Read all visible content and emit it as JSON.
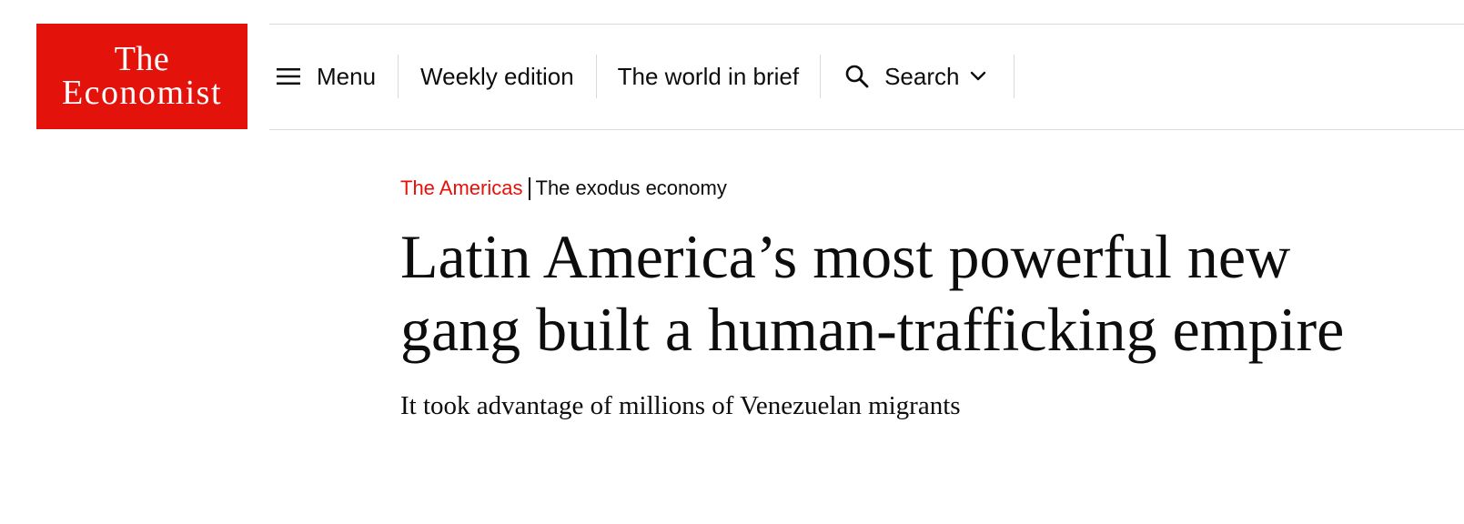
{
  "brand": {
    "logo_line1": "The",
    "logo_line2": "Economist",
    "color": "#e3120b"
  },
  "nav": {
    "menu_label": "Menu",
    "menu_icon": "hamburger-icon",
    "weekly_label": "Weekly edition",
    "brief_label": "The world in brief",
    "search_label": "Search",
    "search_icon": "magnifier-icon",
    "search_chevron": "chevron-down-icon"
  },
  "article": {
    "section": "The Americas",
    "flytitle": "The exodus economy",
    "headline": "Latin America’s most powerful new gang built a human-trafficking empire",
    "subheadline": "It took advantage of millions of Venezuelan migrants"
  }
}
